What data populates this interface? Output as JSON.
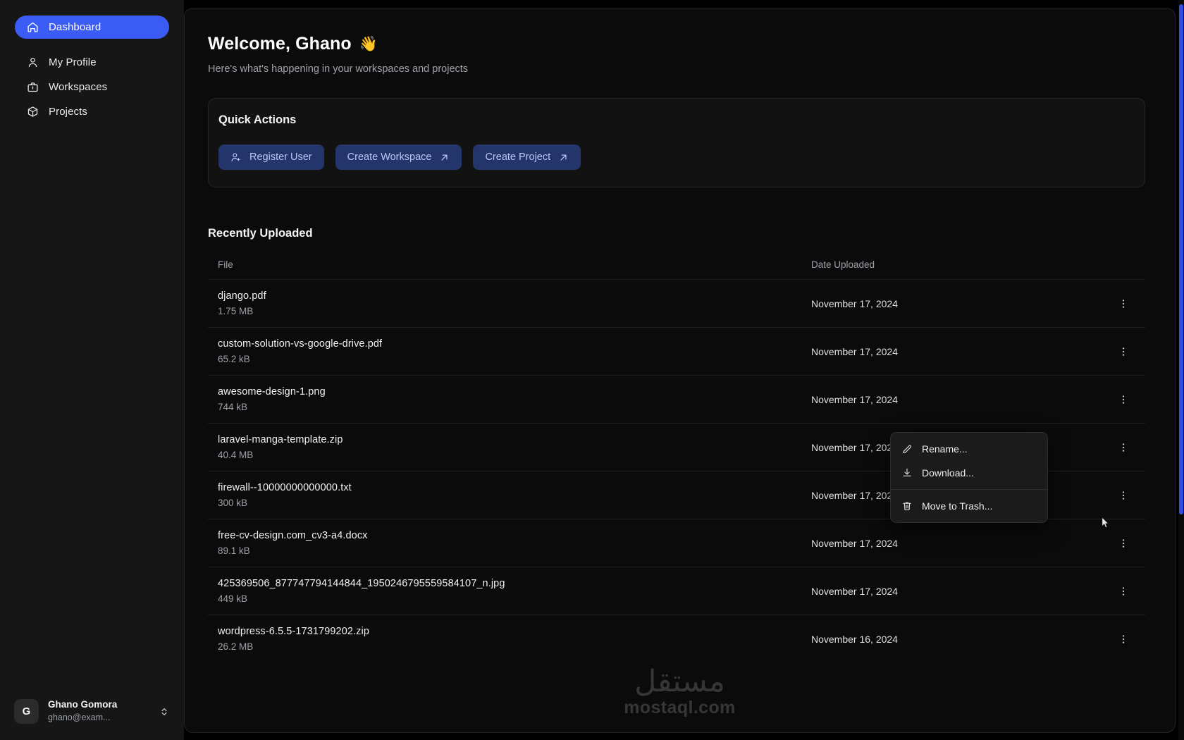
{
  "sidebar": {
    "items": [
      {
        "label": "Dashboard",
        "icon": "home-icon",
        "active": true
      },
      {
        "label": "My Profile",
        "icon": "user-icon",
        "active": false
      },
      {
        "label": "Workspaces",
        "icon": "briefcase-icon",
        "active": false
      },
      {
        "label": "Projects",
        "icon": "cube-icon",
        "active": false
      }
    ],
    "user": {
      "initial": "G",
      "name": "Ghano Gomora",
      "email": "ghano@exam..."
    }
  },
  "header": {
    "title": "Welcome, Ghano",
    "wave_emoji": "👋",
    "subtitle": "Here's what's happening in your workspaces and projects"
  },
  "quick_actions": {
    "title": "Quick Actions",
    "buttons": [
      {
        "label": "Register User",
        "icon": "user-plus-icon",
        "trailing": ""
      },
      {
        "label": "Create Workspace",
        "icon": "",
        "trailing": "arrow-up-right-icon"
      },
      {
        "label": "Create Project",
        "icon": "",
        "trailing": "arrow-up-right-icon"
      }
    ]
  },
  "recently_uploaded": {
    "title": "Recently Uploaded",
    "columns": {
      "file": "File",
      "date": "Date Uploaded"
    },
    "rows": [
      {
        "name": "django.pdf",
        "size": "1.75 MB",
        "date": "November 17, 2024"
      },
      {
        "name": "custom-solution-vs-google-drive.pdf",
        "size": "65.2 kB",
        "date": "November 17, 2024"
      },
      {
        "name": "awesome-design-1.png",
        "size": "744 kB",
        "date": "November 17, 2024"
      },
      {
        "name": "laravel-manga-template.zip",
        "size": "40.4 MB",
        "date": "November 17, 2024"
      },
      {
        "name": "firewall--10000000000000.txt",
        "size": "300 kB",
        "date": "November 17, 2024"
      },
      {
        "name": "free-cv-design.com_cv3-a4.docx",
        "size": "89.1 kB",
        "date": "November 17, 2024"
      },
      {
        "name": "425369506_877747794144844_1950246795559584107_n.jpg",
        "size": "449 kB",
        "date": "November 17, 2024"
      },
      {
        "name": "wordpress-6.5.5-1731799202.zip",
        "size": "26.2 MB",
        "date": "November 16, 2024"
      }
    ]
  },
  "context_menu": {
    "items": [
      {
        "label": "Rename...",
        "icon": "pencil-icon"
      },
      {
        "label": "Download...",
        "icon": "download-icon"
      },
      {
        "label": "Move to Trash...",
        "icon": "trash-icon"
      }
    ]
  },
  "watermark": {
    "arabic": "مستقل",
    "latin": "mostaql.com"
  },
  "colors": {
    "accent": "#3b5bf5",
    "button_bg": "#24356b",
    "button_text": "#b9c7f5",
    "panel_bg": "#0b0b0b",
    "sidebar_bg": "#161616"
  }
}
